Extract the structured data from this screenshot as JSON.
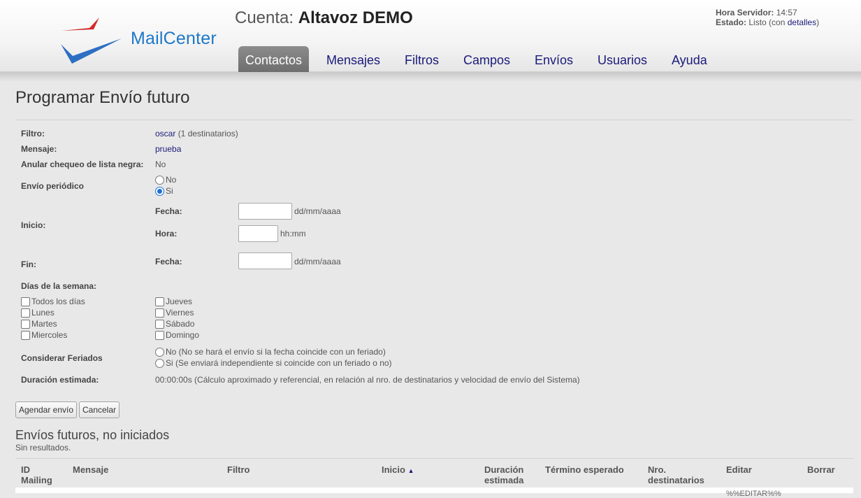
{
  "header": {
    "logo_text": "MailCenter",
    "account_prefix": "Cuenta:",
    "account_name": "Altavoz DEMO",
    "server_time_label": "Hora Servidor:",
    "server_time_value": "14:57",
    "status_label": "Estado:",
    "status_value": "Listo (con",
    "status_link": "detalles",
    "status_suffix": ")"
  },
  "nav": {
    "items": [
      "Contactos",
      "Mensajes",
      "Filtros",
      "Campos",
      "Envíos",
      "Usuarios",
      "Ayuda"
    ],
    "active": "Contactos"
  },
  "page": {
    "title": "Programar Envío futuro"
  },
  "form": {
    "filtro_label": "Filtro:",
    "filtro_link": "oscar",
    "filtro_count": "(1 destinatarios)",
    "mensaje_label": "Mensaje:",
    "mensaje_link": "prueba",
    "anular_label": "Anular chequeo de lista negra:",
    "anular_value": "No",
    "periodico_label": "Envío periódico",
    "periodico_no": "No",
    "periodico_si": "Si",
    "inicio_label": "Inicio:",
    "fecha_label": "Fecha:",
    "hora_label": "Hora:",
    "fecha_hint": "dd/mm/aaaa",
    "hora_hint": "hh:mm",
    "fin_label": "Fin:",
    "fin_fecha_label": "Fecha:",
    "fin_fecha_hint": "dd/mm/aaaa",
    "dias_label": "Días de la semana:",
    "days_left": [
      "Todos los días",
      "Lunes",
      "Martes",
      "Miercoles"
    ],
    "days_right": [
      "Jueves",
      "Viernes",
      "Sábado",
      "Domingo"
    ],
    "feriados_label": "Considerar Feriados",
    "feriados_no": "No (No se hará el envío si la fecha coincide con un feriado)",
    "feriados_si": "Si (Se enviará independiente si coincide con un feriado o no)",
    "duracion_label": "Duración estimada:",
    "duracion_value": "00:00:00s (Cálculo aproximado y referencial, en relación al nro. de destinatarios y velocidad de envío del Sistema)"
  },
  "buttons": {
    "schedule": "Agendar envío",
    "cancel": "Cancelar"
  },
  "future": {
    "title": "Envíos futuros, no iniciados",
    "no_results": "Sin resultados.",
    "columns": {
      "id_line1": "ID",
      "id_line2": "Mailing",
      "mensaje": "Mensaje",
      "filtro": "Filtro",
      "inicio": "Inicio",
      "duracion_line1": "Duración",
      "duracion_line2": "estimada",
      "termino": "Término esperado",
      "nro_line1": "Nro.",
      "nro_line2": "destinatarios",
      "editar": "Editar",
      "borrar": "Borrar"
    },
    "row_fragment": "%%EDITAR%%"
  },
  "colors": {
    "accent": "#1e78c8",
    "nav_link": "#1a1a7a",
    "logo_red": "#d42a2a",
    "active_tab": "#7a7a7a"
  }
}
